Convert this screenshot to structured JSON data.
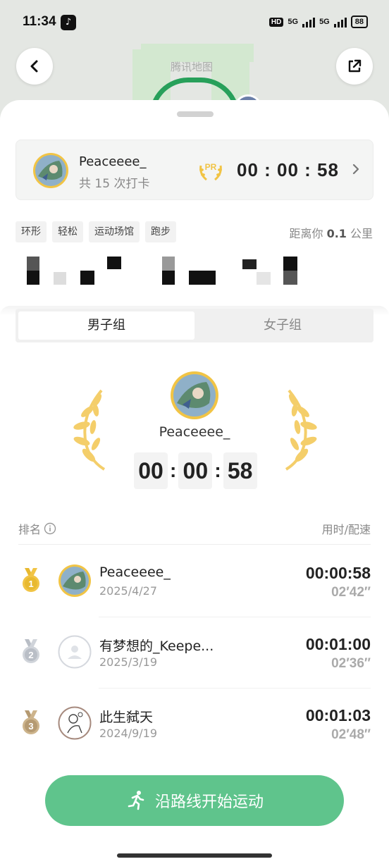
{
  "status_bar": {
    "time": "11:34",
    "hd_label": "HD",
    "net1": "5G",
    "net2": "5G",
    "battery": "88"
  },
  "map": {
    "label": "腾讯地图"
  },
  "pr_card": {
    "username": "Peaceeee_",
    "checkins": "共 15 次打卡",
    "pr_badge": "PR",
    "best_time": "00 : 00 : 58"
  },
  "tags": [
    "环形",
    "轻松",
    "运动场馆",
    "跑步"
  ],
  "distance": {
    "prefix": "距离你 ",
    "value": "0.1",
    "suffix": " 公里"
  },
  "segment": {
    "male": "男子组",
    "female": "女子组"
  },
  "champion": {
    "name": "Peaceeee_",
    "hh": "00",
    "mm": "00",
    "ss": "58"
  },
  "leaderboard": {
    "rank_label": "排名",
    "time_pace_label": "用时/配速",
    "rows": [
      {
        "rank": "1",
        "name": "Peaceeee_",
        "date": "2025/4/27",
        "time": "00:00:58",
        "pace": "02′42″"
      },
      {
        "rank": "2",
        "name": "有梦想的_Keepe...",
        "date": "2025/3/19",
        "time": "00:01:00",
        "pace": "02′36″"
      },
      {
        "rank": "3",
        "name": "此生弑天",
        "date": "2024/9/19",
        "time": "00:01:03",
        "pace": "02′48″"
      }
    ]
  },
  "start_button": {
    "label": "沿路线开始运动"
  },
  "colors": {
    "accent_green": "#5fc48c",
    "gold": "#f1c445",
    "track_green": "#27a05a"
  }
}
